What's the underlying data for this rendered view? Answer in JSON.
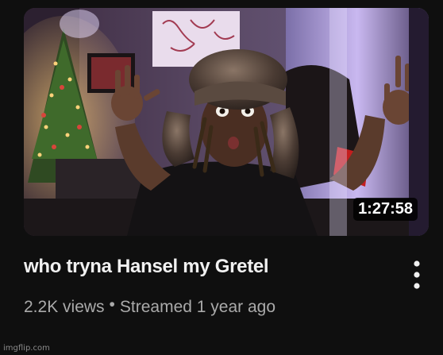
{
  "video": {
    "title": "who tryna Hansel my Gretel",
    "duration": "1:27:58",
    "views": "2.2K views",
    "separator": "•",
    "streamed": "Streamed 1 year ago"
  },
  "icons": {
    "menu": "more-vert-icon"
  },
  "watermark": "imgflip.com",
  "colors": {
    "background": "#0f0f0f",
    "title": "#f1f1f1",
    "secondary_text": "#aaaaaa",
    "duration_badge": "#000000"
  }
}
